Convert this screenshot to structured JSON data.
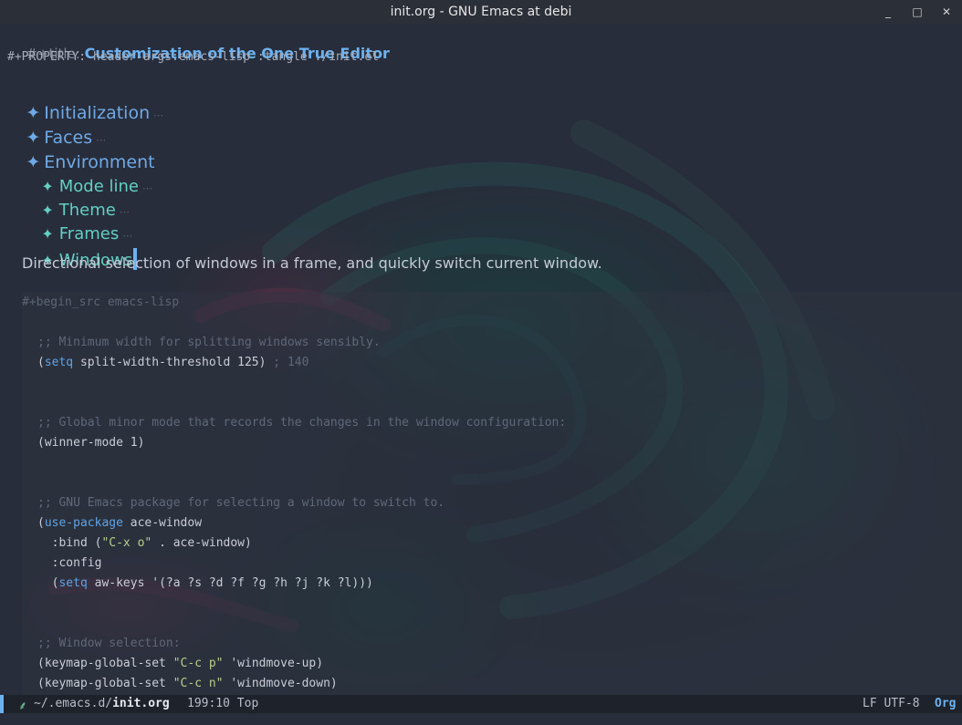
{
  "window": {
    "title": "init.org - GNU Emacs at debi",
    "minimize_glyph": "_",
    "maximize_glyph": "□",
    "close_glyph": "✕"
  },
  "buffer": {
    "title_keyword": "#+title: ",
    "title_text": "Customization of the One True Editor",
    "property_line": "#+PROPERTY: header-args:emacs-lisp :tangle ./init.el",
    "headings": {
      "initialization": "Initialization",
      "faces": "Faces",
      "environment": "Environment",
      "mode_line": "Mode line",
      "theme": "Theme",
      "frames": "Frames",
      "windows": "Windows"
    },
    "star_level1": "✦",
    "star_level2": "✦",
    "fold_marker": "⋯",
    "paragraph": "Directional selection of windows in a frame, and quickly switch current window.",
    "src": {
      "begin": "#+begin_src emacs-lisp",
      "c1": ";; Minimum width for splitting windows sensibly.",
      "l1_open": "(",
      "l1_kw": "setq",
      "l1_rest": " split-width-threshold 125) ",
      "l1_cmt": "; 140",
      "c2": ";; Global minor mode that records the changes in the window configuration:",
      "l2": "(winner-mode 1)",
      "c3": ";; GNU Emacs package for selecting a window to switch to.",
      "l3_open": "(",
      "l3_kw": "use-package",
      "l3_rest": " ace-window",
      "l4_a": "  :bind (",
      "l4_str": "\"C-x o\"",
      "l4_b": " . ace-window)",
      "l5": "  :config",
      "l6_a": "  (",
      "l6_kw": "setq",
      "l6_b": " aw-keys '(?a ?s ?d ?f ?g ?h ?j ?k ?l)))",
      "c4": ";; Window selection:",
      "l7_a": "(keymap-global-set ",
      "l7_str": "\"C-c p\"",
      "l7_b": " 'windmove-up)",
      "l8_a": "(keymap-global-set ",
      "l8_str": "\"C-c n\"",
      "l8_b": " 'windmove-down)"
    }
  },
  "mode_line": {
    "icon": "⸙",
    "path_prefix": "~/.emacs.d/",
    "file_name": "init.org",
    "position": "199:10 Top",
    "encoding": "LF UTF-8",
    "major_mode": "Org"
  },
  "colors": {
    "accent_blue": "#6cb2f0",
    "heading_teal": "#62cfc3",
    "background": "#272d3a"
  }
}
